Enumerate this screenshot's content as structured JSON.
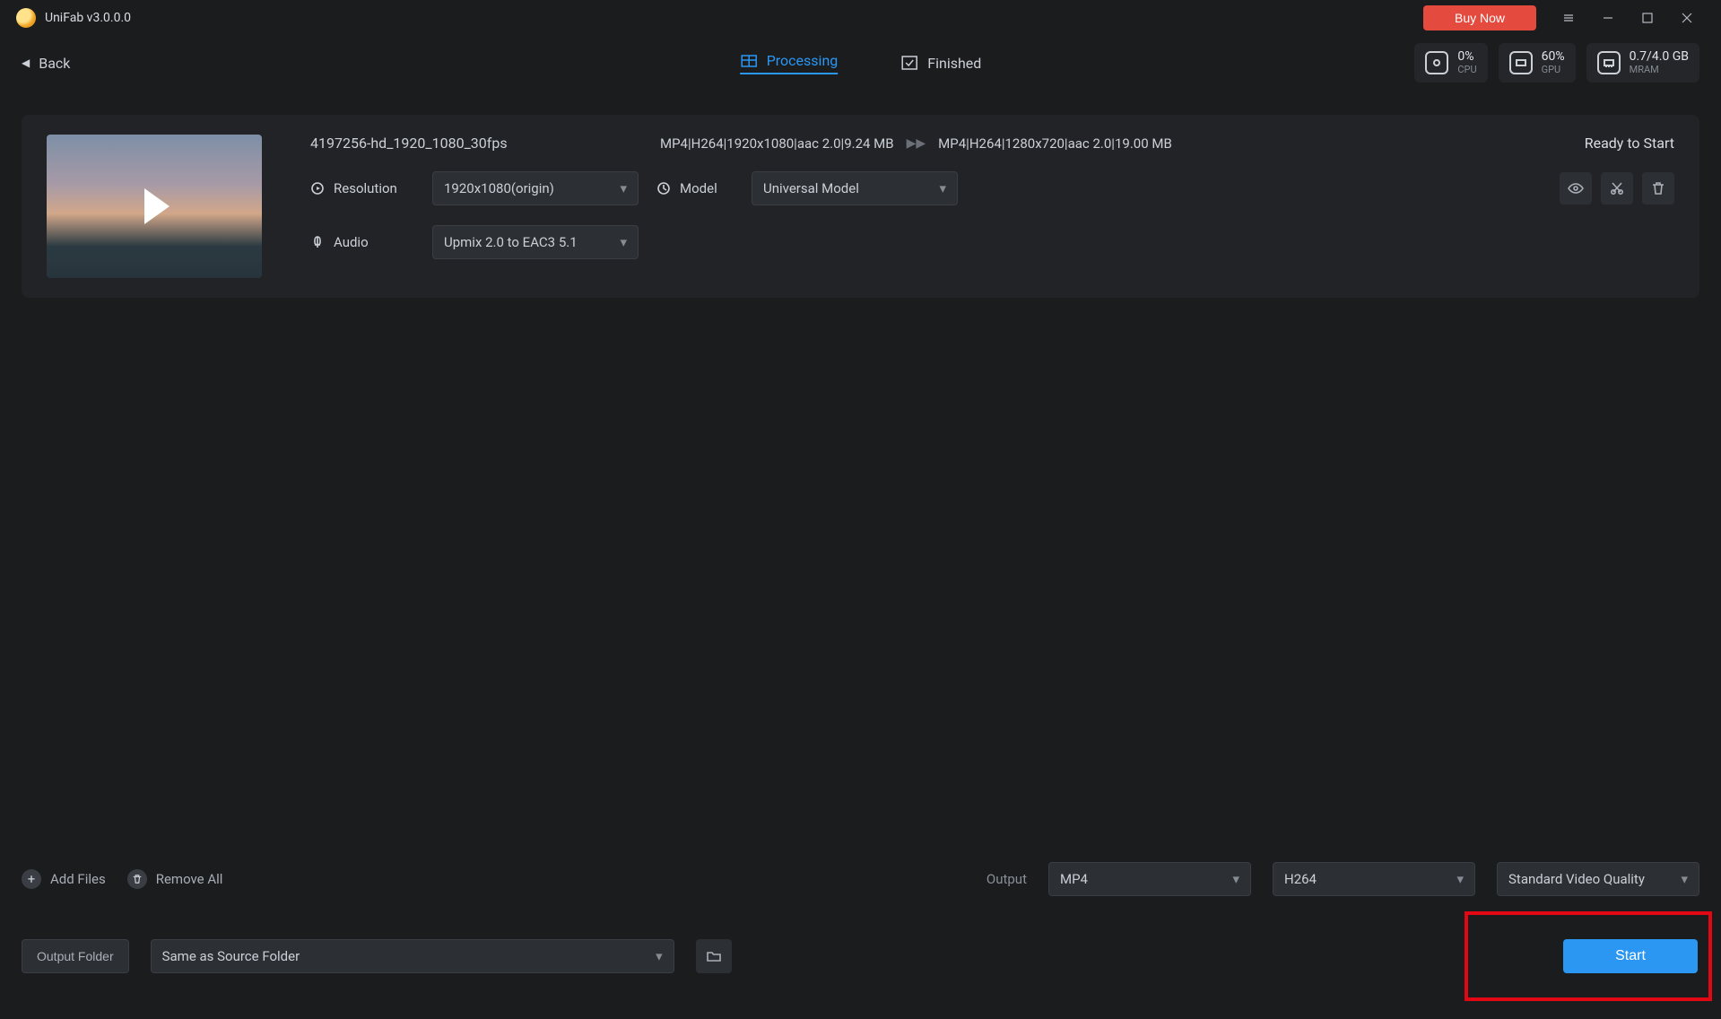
{
  "app": {
    "title": "UniFab v3.0.0.0"
  },
  "header": {
    "buy_now": "Buy Now"
  },
  "nav": {
    "back": "Back"
  },
  "tabs": {
    "processing": "Processing",
    "finished": "Finished"
  },
  "stats": {
    "cpu": {
      "value": "0%",
      "label": "CPU"
    },
    "gpu": {
      "value": "60%",
      "label": "GPU"
    },
    "mram": {
      "value": "0.7/4.0 GB",
      "label": "MRAM"
    }
  },
  "job": {
    "file_name": "4197256-hd_1920_1080_30fps",
    "src_spec": "MP4|H264|1920x1080|aac 2.0|9.24 MB",
    "dst_spec": "MP4|H264|1280x720|aac 2.0|19.00 MB",
    "status": "Ready to Start",
    "labels": {
      "resolution": "Resolution",
      "model": "Model",
      "audio": "Audio"
    },
    "resolution": "1920x1080(origin)",
    "model": "Universal Model",
    "audio": "Upmix 2.0 to EAC3 5.1"
  },
  "bottom": {
    "add_files": "Add Files",
    "remove_all": "Remove All",
    "output_label": "Output",
    "format": "MP4",
    "codec": "H264",
    "quality": "Standard Video Quality"
  },
  "folder": {
    "button": "Output Folder",
    "path": "Same as Source Folder"
  },
  "start": {
    "label": "Start"
  }
}
